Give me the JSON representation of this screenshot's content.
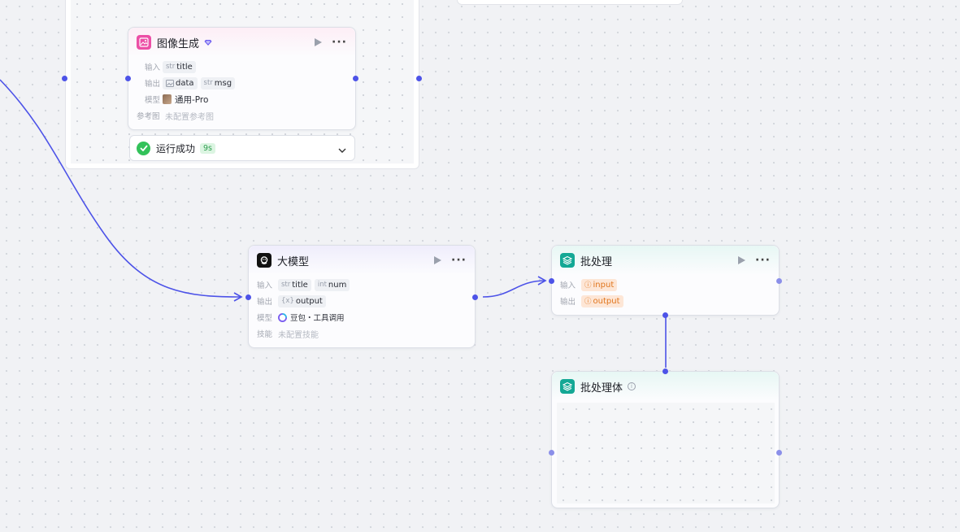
{
  "canvas": {
    "accent_color": "#4d53e8"
  },
  "image_node": {
    "title": "图像生成",
    "icon": "image-icon",
    "icon_color": "#ec4fa6",
    "badge_icon": "diamond-icon",
    "input_label": "输入",
    "inputs": [
      {
        "type": "str",
        "name": "title"
      }
    ],
    "output_label": "输出",
    "outputs": [
      {
        "type": "image",
        "name": "data"
      },
      {
        "type": "str",
        "name": "msg"
      }
    ],
    "model_label": "模型",
    "model_value": "通用-Pro",
    "ref_label": "参考图",
    "ref_value": "未配置参考图"
  },
  "run_status": {
    "text": "运行成功",
    "duration": "9s",
    "status_color": "#33c25a"
  },
  "llm_node": {
    "title": "大模型",
    "icon": "llm-icon",
    "input_label": "输入",
    "inputs": [
      {
        "type": "str",
        "name": "title"
      },
      {
        "type": "int",
        "name": "num"
      }
    ],
    "output_label": "输出",
    "outputs": [
      {
        "type": "{x}",
        "name": "output"
      }
    ],
    "model_label": "模型",
    "model_value": "豆包・工具调用",
    "skill_label": "技能",
    "skill_value": "未配置技能"
  },
  "batch_node": {
    "title": "批处理",
    "icon": "batch-icon",
    "icon_color": "#14a895",
    "input_label": "输入",
    "input_value": "input",
    "output_label": "输出",
    "output_value": "output"
  },
  "batch_body": {
    "title": "批处理体",
    "icon": "batch-icon"
  }
}
